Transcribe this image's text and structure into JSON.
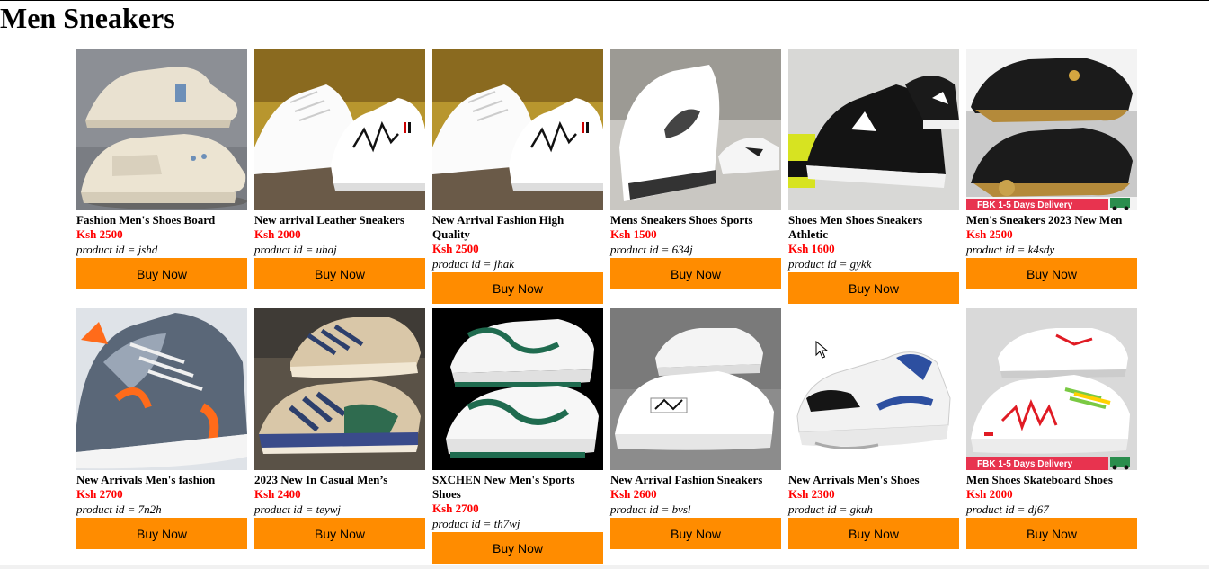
{
  "page": {
    "title": "Men Sneakers"
  },
  "buy_label": "Buy Now",
  "products": [
    {
      "name": "Fashion Men's Shoes Board",
      "price": "Ksh 2500",
      "product_id": "product id = jshd",
      "image": "beige-high-top-sneakers",
      "banner": ""
    },
    {
      "name": "New arrival Leather Sneakers",
      "price": "Ksh 2000",
      "product_id": "product id = uhaj",
      "image": "white-leather-sneakers",
      "banner": ""
    },
    {
      "name": "New Arrival Fashion High Quality",
      "price": "Ksh 2500",
      "product_id": "product id = jhak",
      "image": "white-leather-sneakers",
      "banner": ""
    },
    {
      "name": "Mens Sneakers Shoes Sports",
      "price": "Ksh 1500",
      "product_id": "product id = 634j",
      "image": "white-feather-sneakers",
      "banner": ""
    },
    {
      "name": "Shoes Men Shoes Sneakers Athletic",
      "price": "Ksh 1600",
      "product_id": "product id = gykk",
      "image": "black-canvas-sneakers",
      "banner": ""
    },
    {
      "name": "Men's Sneakers 2023 New Men",
      "price": "Ksh 2500",
      "product_id": "product id = k4sdy",
      "image": "black-gold-sneakers",
      "banner": "FBK 1-5 Days Delivery"
    },
    {
      "name": "New Arrivals Men's fashion",
      "price": "Ksh 2700",
      "product_id": "product id = 7n2h",
      "image": "grey-orange-runners",
      "banner": ""
    },
    {
      "name": "2023 New In Casual Men’s",
      "price": "Ksh 2400",
      "product_id": "product id = teywj",
      "image": "beige-green-runners",
      "banner": ""
    },
    {
      "name": "SXCHEN New Men's Sports Shoes",
      "price": "Ksh 2700",
      "product_id": "product id = th7wj",
      "image": "white-green-chunky-sneakers",
      "banner": ""
    },
    {
      "name": "New Arrival Fashion Sneakers",
      "price": "Ksh 2600",
      "product_id": "product id = bvsl",
      "image": "white-super-sneakers",
      "banner": ""
    },
    {
      "name": "New Arrivals Men's Shoes",
      "price": "Ksh 2300",
      "product_id": "product id = gkuh",
      "image": "white-blue-runner",
      "banner": ""
    },
    {
      "name": "Men Shoes Skateboard Shoes",
      "price": "Ksh 2000",
      "product_id": "product id = dj67",
      "image": "white-red-skate-shoes",
      "banner": "FBK 1-5 Days Delivery"
    }
  ],
  "colors": {
    "buy_button": "#ff8c00",
    "price": "#ff0000",
    "banner": "#e8334f"
  },
  "cursor": {
    "icon": "mouse-pointer-icon"
  }
}
